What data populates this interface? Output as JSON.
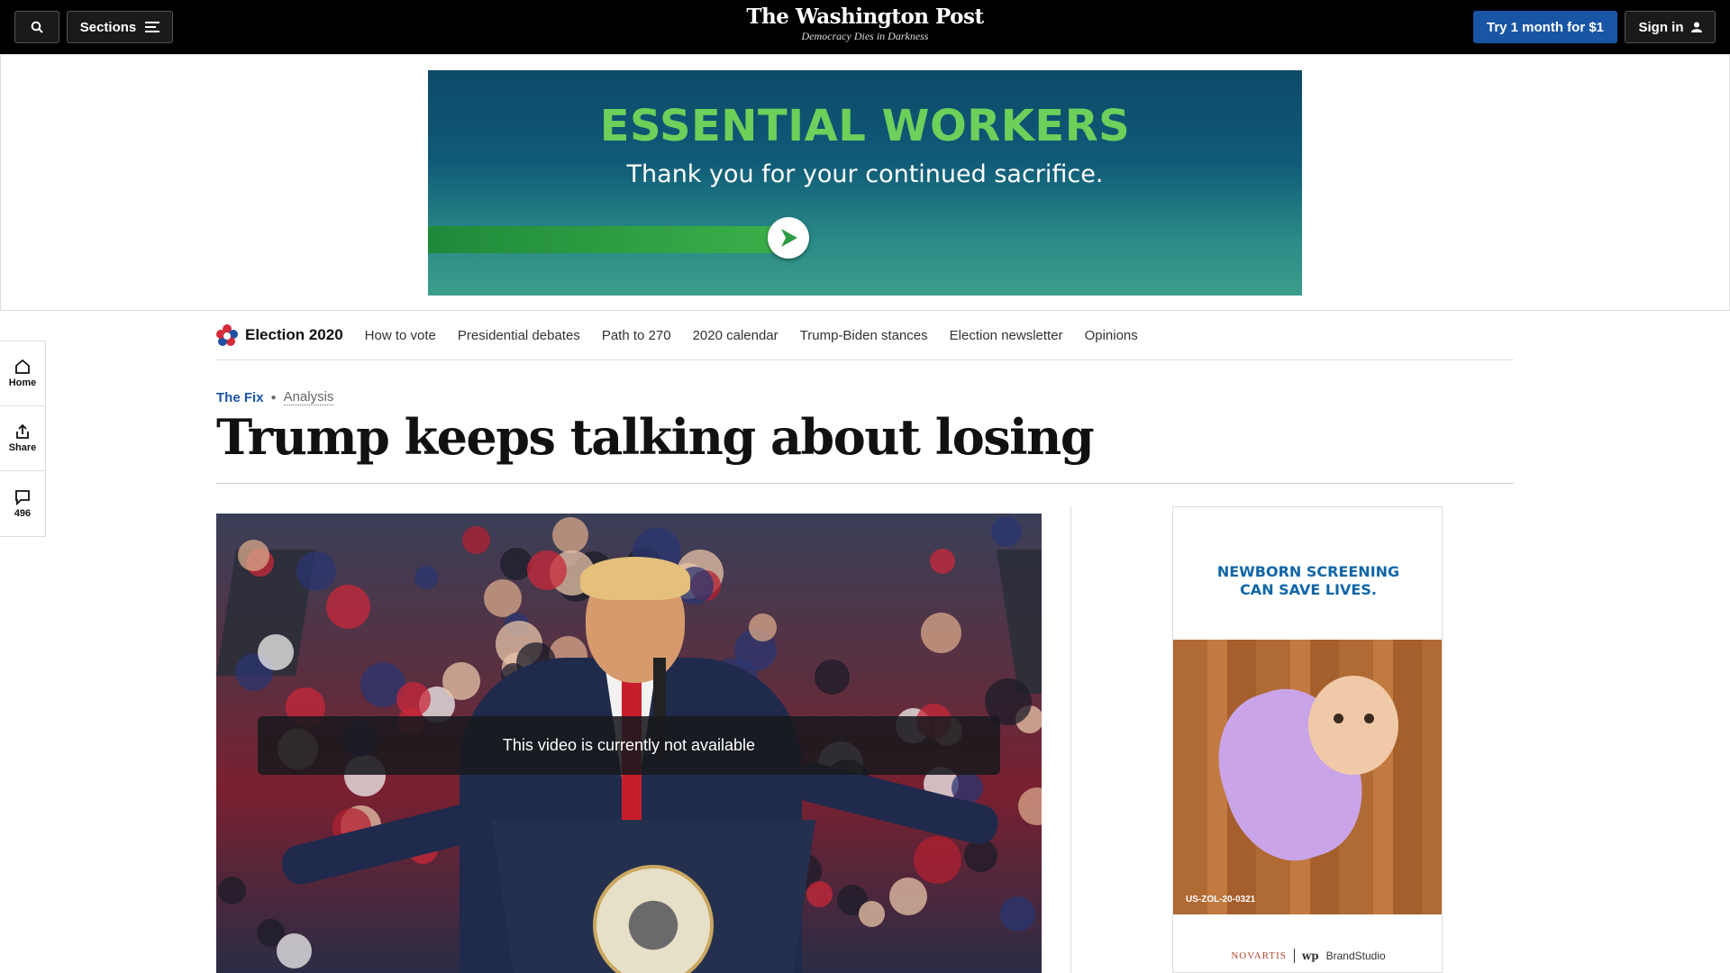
{
  "topbar": {
    "sections_label": "Sections",
    "logo": "The Washington Post",
    "tagline": "Democracy Dies in Darkness",
    "subscribe_label": "Try 1 month for $1",
    "signin_label": "Sign in"
  },
  "ad_banner": {
    "headline": "ESSENTIAL WORKERS",
    "subtext": "Thank you for your continued sacrifice."
  },
  "election_nav": {
    "brand": "Election 2020",
    "items": [
      "How to vote",
      "Presidential debates",
      "Path to 270",
      "2020 calendar",
      "Trump-Biden stances",
      "Election newsletter",
      "Opinions"
    ]
  },
  "rail": {
    "home_label": "Home",
    "share_label": "Share",
    "comments_count": "496"
  },
  "article": {
    "section": "The Fix",
    "label": "Analysis",
    "headline": "Trump keeps talking about losing"
  },
  "video": {
    "message": "This video is currently not available"
  },
  "side_ad": {
    "headline_line1": "NEWBORN SCREENING",
    "headline_line2": "CAN SAVE LIVES.",
    "code": "US-ZOL-20-0321",
    "sponsor": "NOVARTIS",
    "studio": "BrandStudio",
    "wp_mark": "wp"
  },
  "colors": {
    "topbar_bg": "#000000",
    "subscribe_blue": "#1955a5",
    "ad_green": "#6dd05a",
    "side_ad_blue": "#1166a8"
  }
}
